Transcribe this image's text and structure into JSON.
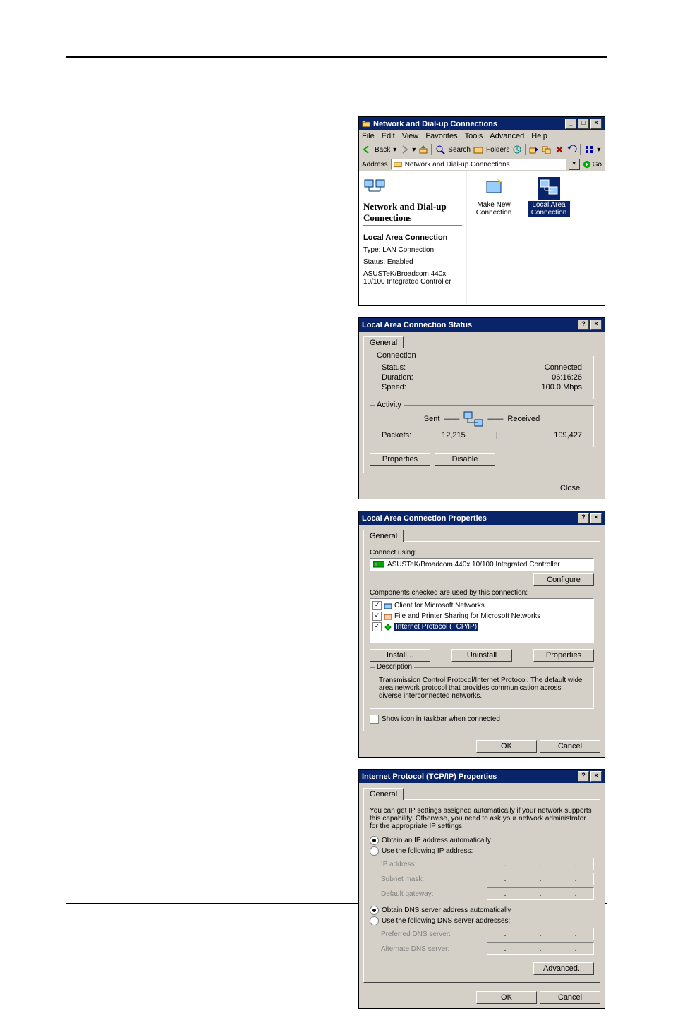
{
  "explorer": {
    "title": "Network and Dial-up Connections",
    "menu": [
      "File",
      "Edit",
      "View",
      "Favorites",
      "Tools",
      "Advanced",
      "Help"
    ],
    "back": "Back",
    "search": "Search",
    "folders": "Folders",
    "address_label": "Address",
    "address_value": "Network and Dial-up Connections",
    "go": "Go",
    "left": {
      "title": "Network and Dial-up Connections",
      "heading": "Local Area Connection",
      "type": "Type: LAN Connection",
      "status": "Status: Enabled",
      "device": "ASUSTeK/Broadcom 440x 10/100 Integrated Controller"
    },
    "icons": {
      "make_new": "Make New Connection",
      "lac": "Local Area Connection"
    }
  },
  "status": {
    "title": "Local Area Connection Status",
    "tab": "General",
    "conn_label": "Connection",
    "status_l": "Status:",
    "status_v": "Connected",
    "duration_l": "Duration:",
    "duration_v": "06:16:26",
    "speed_l": "Speed:",
    "speed_v": "100.0 Mbps",
    "act_label": "Activity",
    "sent": "Sent",
    "recv": "Received",
    "packets_l": "Packets:",
    "packets_sent": "12,215",
    "packets_recv": "109,427",
    "properties": "Properties",
    "disable": "Disable",
    "close": "Close"
  },
  "props": {
    "title": "Local Area Connection Properties",
    "tab": "General",
    "connect_using": "Connect using:",
    "adapter": "ASUSTeK/Broadcom 440x 10/100 Integrated Controller",
    "configure": "Configure",
    "components_label": "Components checked are used by this connection:",
    "c1": "Client for Microsoft Networks",
    "c2": "File and Printer Sharing for Microsoft Networks",
    "c3": "Internet Protocol (TCP/IP)",
    "install": "Install...",
    "uninstall": "Uninstall",
    "properties": "Properties",
    "desc_label": "Description",
    "desc": "Transmission Control Protocol/Internet Protocol. The default wide area network protocol that provides communication across diverse interconnected networks.",
    "show_icon": "Show icon in taskbar when connected",
    "ok": "OK",
    "cancel": "Cancel"
  },
  "tcp": {
    "title": "Internet Protocol (TCP/IP) Properties",
    "tab": "General",
    "intro": "You can get IP settings assigned automatically if your network supports this capability. Otherwise, you need to ask your network administrator for the appropriate IP settings.",
    "r1": "Obtain an IP address automatically",
    "r2": "Use the following IP address:",
    "ip": "IP address:",
    "mask": "Subnet mask:",
    "gw": "Default gateway:",
    "r3": "Obtain DNS server address automatically",
    "r4": "Use the following DNS server addresses:",
    "pdns": "Preferred DNS server:",
    "adns": "Alternate DNS server:",
    "advanced": "Advanced...",
    "ok": "OK",
    "cancel": "Cancel"
  }
}
